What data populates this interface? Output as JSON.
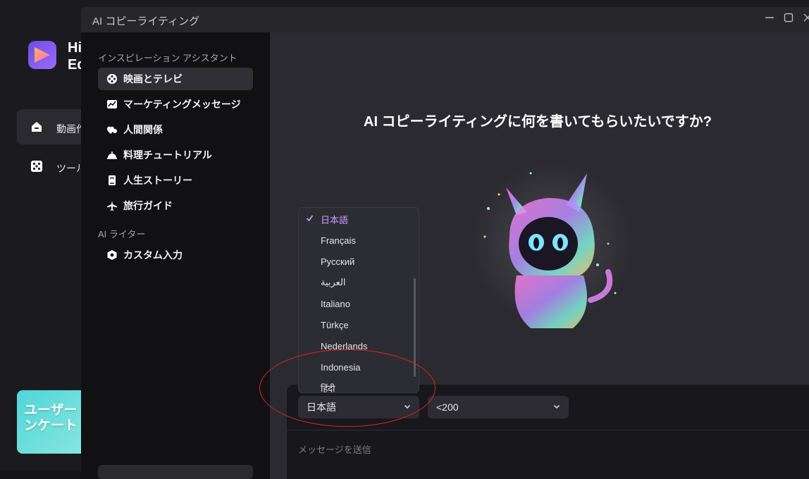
{
  "background_app": {
    "app_name": "Hi Ed",
    "nav": [
      {
        "label": "動画作",
        "icon": "home-icon"
      },
      {
        "label": "ツール",
        "icon": "dice-icon"
      }
    ],
    "promo": {
      "line1": "ユーザー",
      "line2": "ンケート"
    }
  },
  "dialog": {
    "title": "AI コピーライティング",
    "window_controls": [
      "minimize",
      "maximize",
      "close"
    ],
    "sections": [
      {
        "label": "インスピレーション アシスタント",
        "items": [
          {
            "label": "映画とテレビ",
            "icon": "film-reel-icon",
            "active": true
          },
          {
            "label": "マーケティングメッセージ",
            "icon": "chart-icon",
            "active": false
          },
          {
            "label": "人間関係",
            "icon": "hearts-icon",
            "active": false
          },
          {
            "label": "料理チュートリアル",
            "icon": "cloche-icon",
            "active": false
          },
          {
            "label": "人生ストーリー",
            "icon": "book-icon",
            "active": false
          },
          {
            "label": "旅行ガイド",
            "icon": "airplane-icon",
            "active": false
          }
        ]
      },
      {
        "label": "AI ライター",
        "items": [
          {
            "label": "カスタム入力",
            "icon": "hexagon-icon",
            "active": false
          }
        ]
      }
    ],
    "main": {
      "heading": "AI コピーライティングに何を書いてもらいたいですか?",
      "language_select": {
        "value": "日本語"
      },
      "length_select": {
        "value": "<200"
      },
      "message_placeholder": "メッセージを送信"
    },
    "language_dropdown": {
      "options": [
        {
          "label": "日本語",
          "selected": true
        },
        {
          "label": "Français",
          "selected": false
        },
        {
          "label": "Русский",
          "selected": false
        },
        {
          "label": "العربية",
          "selected": false
        },
        {
          "label": "Italiano",
          "selected": false
        },
        {
          "label": "Türkçe",
          "selected": false
        },
        {
          "label": "Nederlands",
          "selected": false
        },
        {
          "label": "Indonesia",
          "selected": false
        },
        {
          "label": "हिंदी",
          "selected": false
        }
      ]
    }
  },
  "colors": {
    "accent": "#c79cff",
    "annotation": "#d6262b",
    "panel_bg": "#111114",
    "main_bg": "#2a2a30"
  }
}
